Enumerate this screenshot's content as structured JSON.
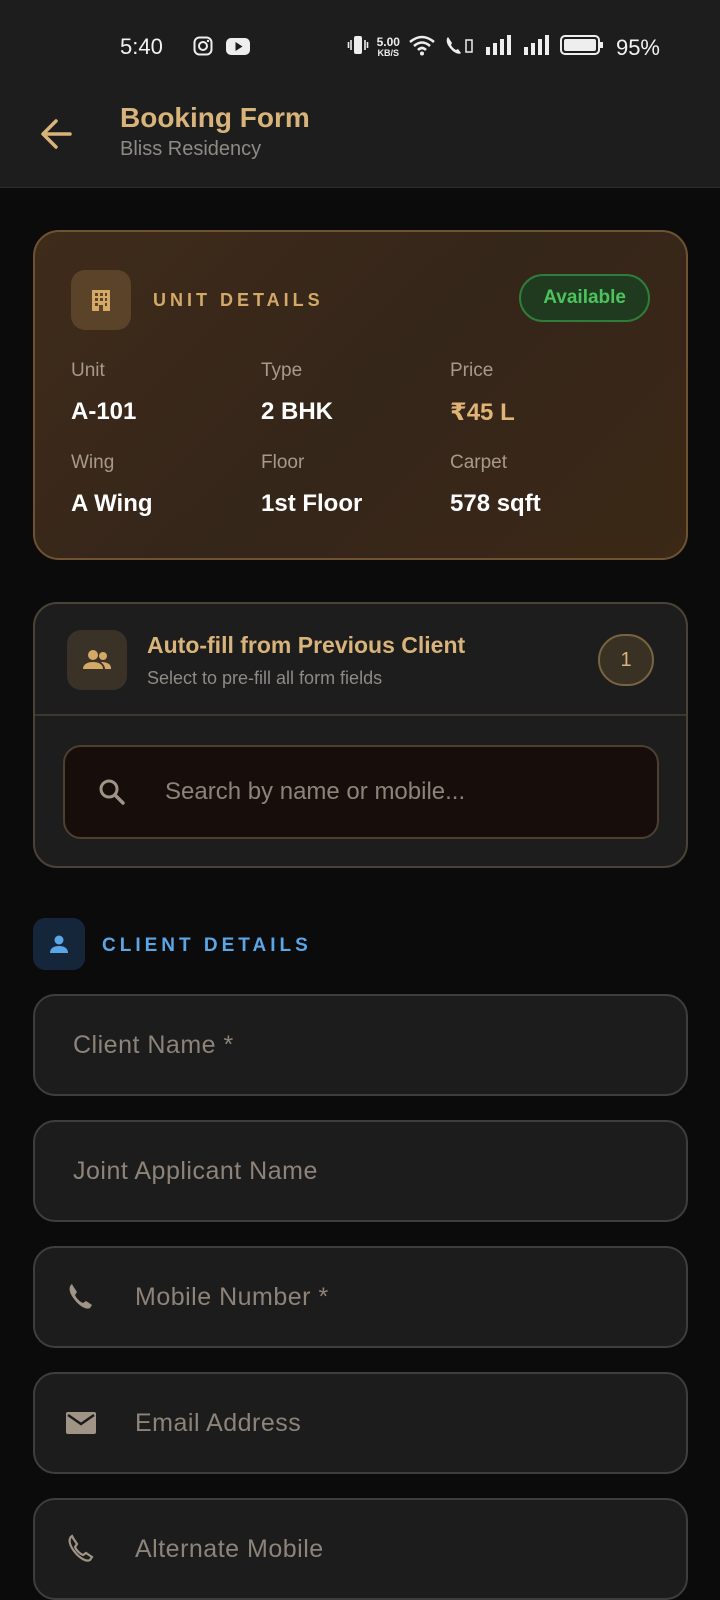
{
  "status": {
    "time": "5:40",
    "speed_top": "5.00",
    "speed_bottom": "KB/S",
    "battery": "95%"
  },
  "appbar": {
    "title": "Booking Form",
    "subtitle": "Bliss Residency"
  },
  "unit": {
    "heading": "UNIT DETAILS",
    "status": "Available",
    "fields": [
      {
        "label": "Unit",
        "value": "A-101"
      },
      {
        "label": "Type",
        "value": "2 BHK"
      },
      {
        "label": "Price",
        "value": "₹45 L"
      },
      {
        "label": "Wing",
        "value": "A Wing"
      },
      {
        "label": "Floor",
        "value": "1st Floor"
      },
      {
        "label": "Carpet",
        "value": "578 sqft"
      }
    ]
  },
  "autofill": {
    "title": "Auto-fill from Previous Client",
    "subtitle": "Select to pre-fill all form fields",
    "count": "1",
    "search_placeholder": "Search by name or mobile..."
  },
  "client": {
    "section_title": "CLIENT DETAILS",
    "fields": [
      {
        "placeholder": "Client Name *"
      },
      {
        "placeholder": "Joint Applicant Name"
      },
      {
        "placeholder": "Mobile Number *"
      },
      {
        "placeholder": "Email Address"
      },
      {
        "placeholder": "Alternate Mobile"
      }
    ]
  },
  "colors": {
    "accent_gold": "#d9b47a",
    "available_green": "#4cc35d",
    "client_blue": "#5aa6e6"
  }
}
